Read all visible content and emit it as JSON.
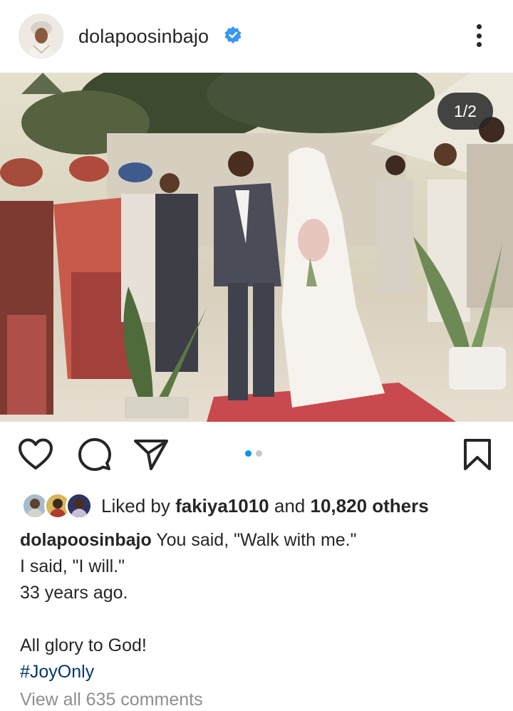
{
  "header": {
    "username": "dolapoosinbajo",
    "verified": true,
    "more_icon": "more-vertical-icon"
  },
  "media": {
    "counter": "1/2",
    "total": 2,
    "current": 1,
    "description_colors": {
      "sky": "#dcd8c6",
      "carpet": "#c84a4e"
    }
  },
  "actions": {
    "like_icon": "heart-icon",
    "comment_icon": "comment-icon",
    "share_icon": "send-icon",
    "save_icon": "bookmark-icon",
    "active_dot_color": "#0095f6"
  },
  "likes": {
    "prefix": "Liked by",
    "user": "fakiya1010",
    "connector": "and",
    "others": "10,820 others"
  },
  "caption": {
    "username": "dolapoosinbajo",
    "line1": "You said, \"Walk with me.\"",
    "line2": "I said, \"I will.\"",
    "line3": "33 years ago.",
    "line4": "All glory to God!",
    "hashtag": "#JoyOnly"
  },
  "comments": {
    "view_all": "View all 635 comments"
  }
}
